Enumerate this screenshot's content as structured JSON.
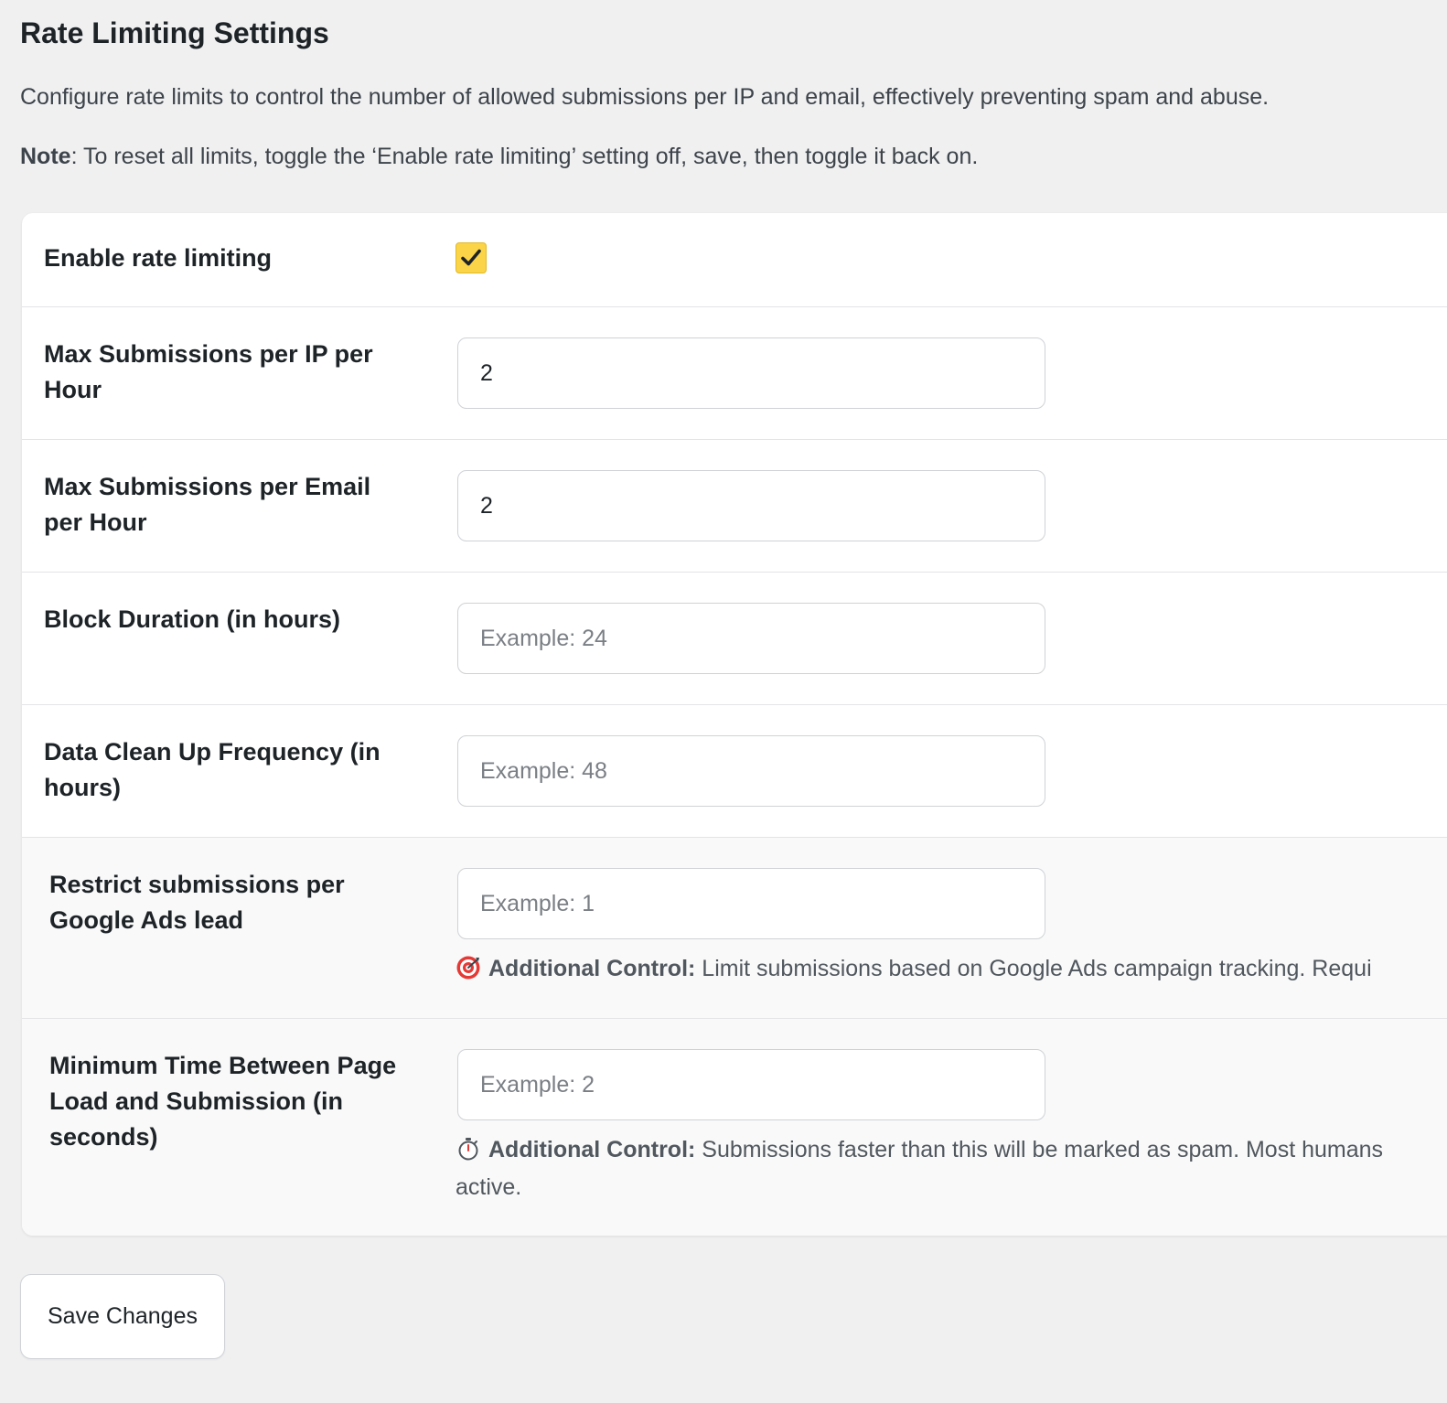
{
  "page": {
    "title": "Rate Limiting Settings",
    "description": "Configure rate limits to control the number of allowed submissions per IP and email, effectively preventing spam and abuse.",
    "note_label": "Note",
    "note_text": ": To reset all limits, toggle the ‘Enable rate limiting’ setting off, save, then toggle it back on."
  },
  "settings": {
    "enable": {
      "label": "Enable rate limiting",
      "checked": true
    },
    "max_ip": {
      "label": "Max Submissions per IP per Hour",
      "value": "2",
      "placeholder": ""
    },
    "max_email": {
      "label": "Max Submissions per Email per Hour",
      "value": "2",
      "placeholder": ""
    },
    "block_duration": {
      "label": "Block Duration (in hours)",
      "value": "",
      "placeholder": "Example: 24"
    },
    "cleanup": {
      "label": "Data Clean Up Frequency (in hours)",
      "value": "",
      "placeholder": "Example: 48"
    },
    "google_ads": {
      "label": "Restrict submissions per Google Ads lead",
      "value": "",
      "placeholder": "Example: 1",
      "help_icon": "target-icon",
      "help_bold": "Additional Control:",
      "help_text": " Limit submissions based on Google Ads campaign tracking. Requi"
    },
    "min_time": {
      "label": "Minimum Time Between Page Load and Submission (in seconds)",
      "value": "",
      "placeholder": "Example: 2",
      "help_icon": "stopwatch-icon",
      "help_bold": "Additional Control:",
      "help_text": " Submissions faster than this will be marked as spam. Most humans",
      "help_text_2": "active."
    }
  },
  "actions": {
    "save_label": "Save Changes"
  },
  "colors": {
    "background": "#f0f0f1",
    "card": "#ffffff",
    "checkbox_fill": "#fbd448",
    "target_icon": "#e53935"
  }
}
